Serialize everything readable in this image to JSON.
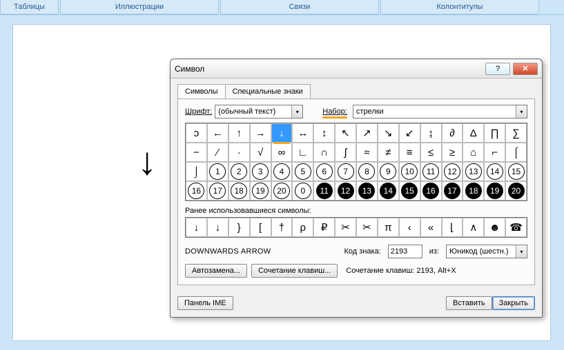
{
  "ribbon": {
    "groups": [
      "Таблицы",
      "Иллюстрации",
      "Связи",
      "Колонтитулы"
    ]
  },
  "document": {
    "preview_symbol": "↓"
  },
  "dialog": {
    "title": "Символ",
    "help_icon": "?",
    "close_icon": "✕",
    "tabs": {
      "symbols": "Символы",
      "special": "Специальные знаки"
    },
    "font_label": "Шрифт:",
    "font_value": "(обычный текст)",
    "set_label": "Набор:",
    "set_value": "стрелки",
    "grid": [
      [
        {
          "g": "ↄ"
        },
        {
          "g": "←"
        },
        {
          "g": "↑"
        },
        {
          "g": "→"
        },
        {
          "g": "↓",
          "sel": true
        },
        {
          "g": "↔"
        },
        {
          "g": "↕"
        },
        {
          "g": "↖"
        },
        {
          "g": "↗"
        },
        {
          "g": "↘"
        },
        {
          "g": "↙"
        },
        {
          "g": "↨"
        },
        {
          "g": "∂"
        },
        {
          "g": "Δ"
        },
        {
          "g": "∏"
        },
        {
          "g": "∑"
        }
      ],
      [
        {
          "g": "−"
        },
        {
          "g": "∕"
        },
        {
          "g": "·"
        },
        {
          "g": "√"
        },
        {
          "g": "∞"
        },
        {
          "g": "∟"
        },
        {
          "g": "∩"
        },
        {
          "g": "∫"
        },
        {
          "g": "≈"
        },
        {
          "g": "≠"
        },
        {
          "g": "≡"
        },
        {
          "g": "≤"
        },
        {
          "g": "≥"
        },
        {
          "g": "⌂"
        },
        {
          "g": "⌐"
        },
        {
          "g": "⌠"
        }
      ],
      [
        {
          "g": "⌡"
        },
        {
          "g": "1",
          "circ": true
        },
        {
          "g": "2",
          "circ": true
        },
        {
          "g": "3",
          "circ": true
        },
        {
          "g": "4",
          "circ": true
        },
        {
          "g": "5",
          "circ": true
        },
        {
          "g": "6",
          "circ": true
        },
        {
          "g": "7",
          "circ": true
        },
        {
          "g": "8",
          "circ": true
        },
        {
          "g": "9",
          "circ": true
        },
        {
          "g": "10",
          "circ": true
        },
        {
          "g": "11",
          "circ": true
        },
        {
          "g": "12",
          "circ": true
        },
        {
          "g": "13",
          "circ": true
        },
        {
          "g": "14",
          "circ": true
        },
        {
          "g": "15",
          "circ": true
        }
      ],
      [
        {
          "g": "16",
          "circ": true
        },
        {
          "g": "17",
          "circ": true
        },
        {
          "g": "18",
          "circ": true
        },
        {
          "g": "19",
          "circ": true
        },
        {
          "g": "20",
          "circ": true
        },
        {
          "g": "0",
          "circ": true
        },
        {
          "g": "11",
          "circ": true,
          "black": true
        },
        {
          "g": "12",
          "circ": true,
          "black": true
        },
        {
          "g": "13",
          "circ": true,
          "black": true
        },
        {
          "g": "14",
          "circ": true,
          "black": true
        },
        {
          "g": "15",
          "circ": true,
          "black": true
        },
        {
          "g": "16",
          "circ": true,
          "black": true
        },
        {
          "g": "17",
          "circ": true,
          "black": true
        },
        {
          "g": "18",
          "circ": true,
          "black": true
        },
        {
          "g": "19",
          "circ": true,
          "black": true
        },
        {
          "g": "20",
          "circ": true,
          "black": true
        }
      ]
    ],
    "recent_label": "Ранее использовавшиеся символы:",
    "recent": [
      {
        "g": "↓"
      },
      {
        "g": "↓"
      },
      {
        "g": "}"
      },
      {
        "g": "["
      },
      {
        "g": "†"
      },
      {
        "g": "ρ"
      },
      {
        "g": "₽"
      },
      {
        "g": "✂"
      },
      {
        "g": "✂"
      },
      {
        "g": "π"
      },
      {
        "g": "‹"
      },
      {
        "g": "«"
      },
      {
        "g": "⌊"
      },
      {
        "g": "∧"
      },
      {
        "g": "☻"
      },
      {
        "g": "☎"
      }
    ],
    "char_name": "DOWNWARDS ARROW",
    "code_label": "Код знака:",
    "code_value": "2193",
    "from_label": "из:",
    "from_value": "Юникод (шестн.)",
    "btn_autocorrect": "Автозамена...",
    "btn_shortcut": "Сочетание клавиш...",
    "shortcut_text": "Сочетание клавиш: 2193, Alt+X",
    "btn_ime": "Панель IME",
    "btn_insert": "Вставить",
    "btn_close": "Закрыть"
  }
}
